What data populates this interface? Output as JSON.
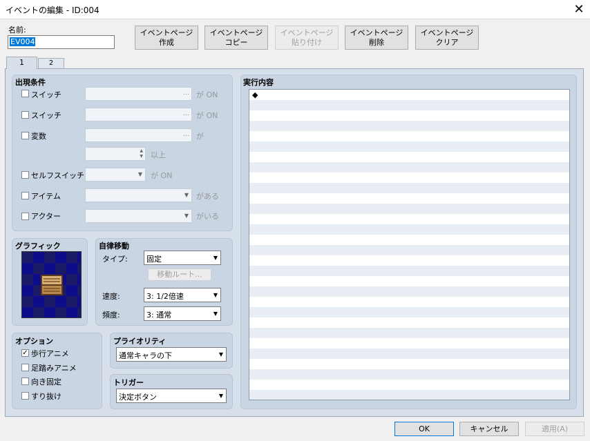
{
  "window": {
    "title": "イベントの編集 - ID:004",
    "close_glyph": "✕"
  },
  "name_field": {
    "label": "名前:",
    "value": "EV004"
  },
  "page_buttons": {
    "create": [
      "イベントページ",
      "作成"
    ],
    "copy": [
      "イベントページ",
      "コピー"
    ],
    "paste": [
      "イベントページ",
      "貼り付け"
    ],
    "delete": [
      "イベントページ",
      "削除"
    ],
    "clear": [
      "イベントページ",
      "クリア"
    ]
  },
  "tabs": [
    "1",
    "2"
  ],
  "conditions": {
    "title": "出現条件",
    "switch1": {
      "label": "スイッチ",
      "suffix": "が ON"
    },
    "switch2": {
      "label": "スイッチ",
      "suffix": "が ON"
    },
    "variable": {
      "label": "変数",
      "suffix": "が",
      "compare_suffix": "以上"
    },
    "self_switch": {
      "label": "セルフスイッチ",
      "suffix": "が ON"
    },
    "item": {
      "label": "アイテム",
      "suffix": "がある"
    },
    "actor": {
      "label": "アクター",
      "suffix": "がいる"
    },
    "ellipsis": "...",
    "spin_up": "▲",
    "spin_down": "▼",
    "dropdown_arrow": "▼"
  },
  "graphic": {
    "title": "グラフィック"
  },
  "autonomous_movement": {
    "title": "自律移動",
    "type_label": "タイプ:",
    "type_value": "固定",
    "route_button": "移動ルート...",
    "speed_label": "速度:",
    "speed_value": "3: 1/2倍速",
    "freq_label": "頻度:",
    "freq_value": "3: 通常"
  },
  "options": {
    "title": "オプション",
    "walking": {
      "label": "歩行アニメ",
      "checked": true
    },
    "stepping": {
      "label": "足踏みアニメ",
      "checked": false
    },
    "direction_fix": {
      "label": "向き固定",
      "checked": false
    },
    "through": {
      "label": "すり抜け",
      "checked": false
    },
    "check_glyph": "✓"
  },
  "priority": {
    "title": "プライオリティ",
    "value": "通常キャラの下"
  },
  "trigger": {
    "title": "トリガー",
    "value": "決定ボタン"
  },
  "execution": {
    "title": "実行内容",
    "first_line": "◆"
  },
  "footer": {
    "ok": "OK",
    "cancel": "キャンセル",
    "apply": "適用(A)"
  }
}
